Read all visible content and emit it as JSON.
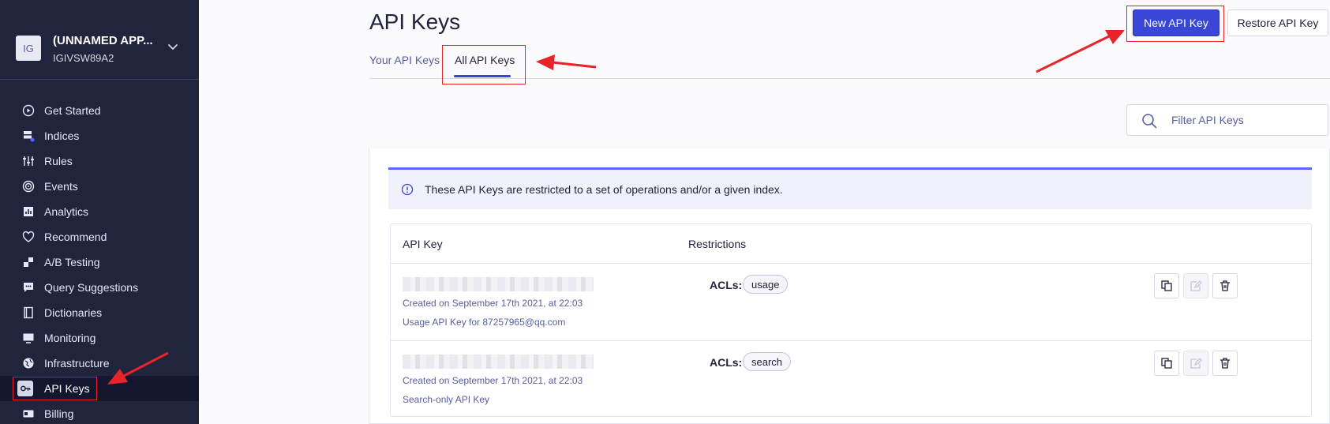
{
  "sidebar": {
    "app": {
      "avatar": "IG",
      "name": "(UNNAMED APP...",
      "id": "IGIVSW89A2"
    },
    "items": [
      {
        "label": "Get Started",
        "icon": "play-circle-icon"
      },
      {
        "label": "Indices",
        "icon": "database-icon"
      },
      {
        "label": "Rules",
        "icon": "sliders-icon"
      },
      {
        "label": "Events",
        "icon": "target-icon"
      },
      {
        "label": "Analytics",
        "icon": "bar-chart-icon"
      },
      {
        "label": "Recommend",
        "icon": "heart-icon"
      },
      {
        "label": "A/B Testing",
        "icon": "ab-test-icon"
      },
      {
        "label": "Query Suggestions",
        "icon": "chat-icon"
      },
      {
        "label": "Dictionaries",
        "icon": "book-icon"
      },
      {
        "label": "Monitoring",
        "icon": "monitor-icon"
      },
      {
        "label": "Infrastructure",
        "icon": "globe-icon"
      },
      {
        "label": "API Keys",
        "icon": "key-icon",
        "active": true
      },
      {
        "label": "Billing",
        "icon": "credit-card-icon"
      }
    ]
  },
  "header": {
    "title": "API Keys",
    "tabs": [
      {
        "label": "Your API Keys"
      },
      {
        "label": "All API Keys",
        "active": true
      }
    ],
    "new_key_label": "New API Key",
    "restore_key_label": "Restore API Key"
  },
  "filter": {
    "placeholder": "Filter API Keys"
  },
  "banner": {
    "text": "These API Keys are restricted to a set of operations and/or a given index."
  },
  "table": {
    "columns": [
      "API Key",
      "Restrictions"
    ],
    "rows": [
      {
        "created": "Created on September 17th 2021, at 22:03",
        "description": "Usage API Key for 87257965@qq.com",
        "acls_label": "ACLs:",
        "acl": "usage"
      },
      {
        "created": "Created on September 17th 2021, at 22:03",
        "description": "Search-only API Key",
        "acls_label": "ACLs:",
        "acl": "search"
      }
    ]
  },
  "colors": {
    "sidebar_bg": "#21243d",
    "accent": "#3a46d6",
    "annotation": "#e8232a"
  }
}
